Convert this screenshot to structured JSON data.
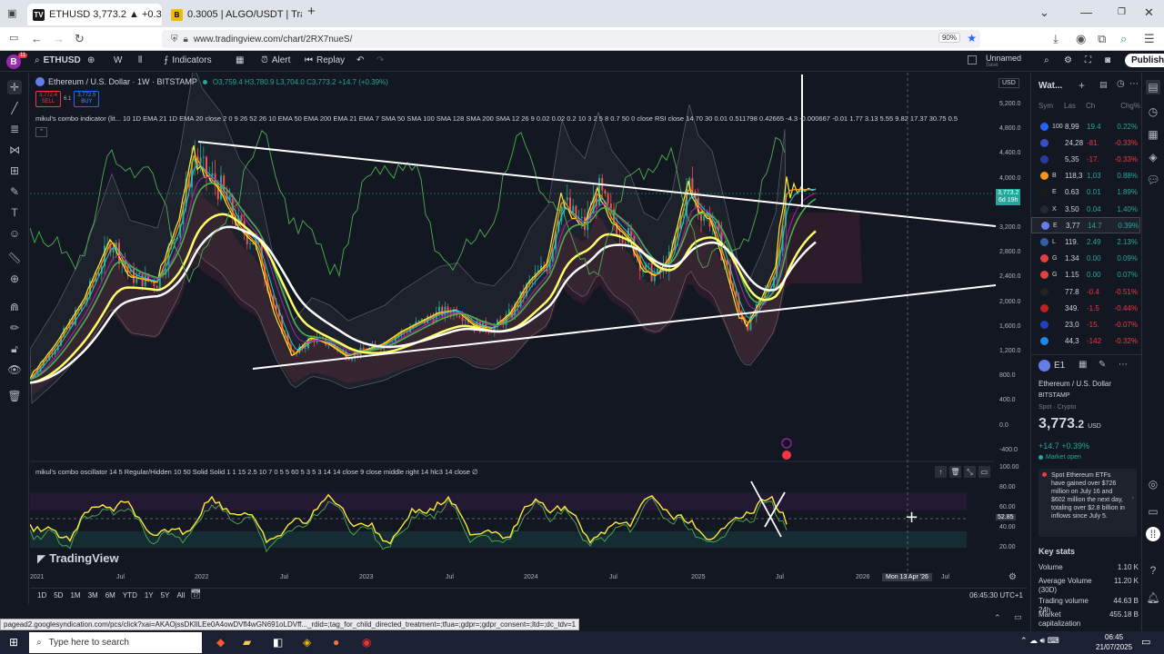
{
  "browser": {
    "tabs": [
      {
        "label": "ETHUSD 3,773.2 ▲ +0.39% Unn",
        "favicon": "tv-icon",
        "active": true
      },
      {
        "label": "0.3005 | ALGO/USDT | Trade AL",
        "favicon": "binance-icon",
        "active": false
      }
    ],
    "url": "www.tradingview.com/chart/2RX7nueS/",
    "zoom": "90%"
  },
  "toolbar": {
    "avatar_letter": "B",
    "avatar_badge": "11",
    "symbol": "ETHUSD",
    "interval": "W",
    "indicators_label": "Indicators",
    "alert_label": "Alert",
    "replay_label": "Replay",
    "layout_name": "Unnamed",
    "layout_sub": "Save",
    "publish_label": "Publish"
  },
  "legend": {
    "title": "Ethereum / U.S. Dollar · 1W · BITSTAMP",
    "ohlc": "O3,759.4 H3,780.9 L3,704.0 C3,773.2 +14.7 (+0.39%)",
    "sell_price": "3,772.4",
    "sell_label": "SELL",
    "spread": "6.1",
    "buy_price": "3,772.5",
    "buy_label": "BUY",
    "indicator1": "mikul's combo indicator (lit... 10 1D EMA 21 1D EMA 20 close 2 0 9 26 52 26 10 EMA 50 EMA 200 EMA 21 EMA 7 SMA 50 SMA 100 SMA 128 SMA 200 SMA 12 26 9 0.02 0.02 0.2 10 3 2 5 8 0.7 50 0 close RSI close 14 70 30 0.01 0.511798 0.42665 -4.3 -0.000667 -0.01 1.77 3.13 5.55 9.82 17.37 30.75 0.5",
    "indicator2": "mikul's combo oscillator 14 5 Regular/Hidden 10 50 Solid Solid 1 1 15 2.5 10 7 0 5 5 60 5 3 5 3 14 14 close 9 close middle right 14 hlc3 14 close ∅"
  },
  "price_axis": {
    "currency": "USD",
    "ticks": [
      "5,200.0",
      "4,800.0",
      "4,400.0",
      "4,000.0",
      "3,600.0",
      "3,200.0",
      "2,800.0",
      "2,400.0",
      "2,000.0",
      "1,600.0",
      "1,200.0",
      "800.0",
      "400.0",
      "0.0",
      "-400.0"
    ],
    "last_price": "3,773.2",
    "countdown": "6d 19h"
  },
  "osc_axis": {
    "ticks": [
      "100.00",
      "80.00",
      "60.00",
      "40.00",
      "20.00"
    ],
    "current": "52.85"
  },
  "time_axis": {
    "labels": [
      "2021",
      "Jul",
      "2022",
      "Jul",
      "2023",
      "Jul",
      "2024",
      "Jul",
      "2025",
      "Jul",
      "2026",
      "Jul"
    ],
    "crosshair_label": "Mon 13 Apr '26"
  },
  "ranges": [
    "1D",
    "5D",
    "1M",
    "3M",
    "6M",
    "YTD",
    "1Y",
    "5Y",
    "All"
  ],
  "clock": "06:45:30 UTC+1",
  "logo": "TradingView",
  "watchlist": {
    "title": "Wat...",
    "headers": [
      "Sym",
      "Las",
      "Ch",
      "Chg%"
    ],
    "rows": [
      {
        "sym": "100",
        "last": "8,99",
        "chg": "19.4",
        "pct": "0.22%",
        "color": "#2962ff",
        "up": true
      },
      {
        "sym": "",
        "last": "24,28",
        "chg": "-81.",
        "pct": "-0.33%",
        "color": "#3b4cca",
        "up": false
      },
      {
        "sym": "",
        "last": "5,35",
        "chg": "-17.",
        "pct": "-0.33%",
        "color": "#2a3aa0",
        "up": false
      },
      {
        "sym": "B",
        "last": "118,3",
        "chg": "1,03",
        "pct": "0.88%",
        "color": "#f7931a",
        "up": true
      },
      {
        "sym": "E",
        "last": "0.63",
        "chg": "0.01",
        "pct": "1.89%",
        "color": "#1a1a1a",
        "up": true
      },
      {
        "sym": "X",
        "last": "3.50",
        "chg": "0.04",
        "pct": "1.40%",
        "color": "#23292f",
        "up": true
      },
      {
        "sym": "E",
        "last": "3,77",
        "chg": "14.7",
        "pct": "0.39%",
        "color": "#627eea",
        "up": true
      },
      {
        "sym": "L",
        "last": "119.",
        "chg": "2.49",
        "pct": "2.13%",
        "color": "#345d9d",
        "up": true
      },
      {
        "sym": "G",
        "last": "1.34",
        "chg": "0.00",
        "pct": "0.09%",
        "color": "#e04040",
        "up": true
      },
      {
        "sym": "G",
        "last": "1.15",
        "chg": "0.00",
        "pct": "0.07%",
        "color": "#e04040",
        "up": true
      },
      {
        "sym": "",
        "last": "77.8",
        "chg": "-0.4",
        "pct": "-0.51%",
        "color": "#222",
        "up": false
      },
      {
        "sym": "",
        "last": "349.",
        "chg": "-1.5",
        "pct": "-0.44%",
        "color": "#c02020",
        "up": false
      },
      {
        "sym": "",
        "last": "23,0",
        "chg": "-15.",
        "pct": "-0.07%",
        "color": "#2040c0",
        "up": false
      },
      {
        "sym": "",
        "last": "44,3",
        "chg": "-142",
        "pct": "-0.32%",
        "color": "#1e88e5",
        "up": false
      }
    ]
  },
  "details": {
    "symbol": "E1",
    "name": "Ethereum / U.S. Dollar",
    "exchange": "BITSTAMP",
    "category": "Spot · Crypto",
    "price_main": "3,773",
    "price_frac": ".2",
    "currency": "USD",
    "change": "+14.7 +0.39%",
    "market_status": "Market open",
    "news": "Spot Ethereum ETFs have gained over $726 million on July 16 and $602 million the next day, totaling over $2.8 billion in inflows since July 5.",
    "key_stats_title": "Key stats",
    "stats": [
      {
        "label": "Volume",
        "value": "1.10 K"
      },
      {
        "label": "Average Volume (30D)",
        "value": "11.20 K"
      },
      {
        "label": "Trading volume 24h",
        "value": "44.63 B"
      },
      {
        "label": "Market capitalization",
        "value": "455.18 B"
      }
    ]
  },
  "status_url": "pagead2.googlesyndication.com/pcs/click?xai=AKAOjssDKlILEe0A4owDVfl4wGN691oLDVff..._rdid=;tag_for_child_directed_treatment=;tfua=;gdpr=;gdpr_consent=;ltd=;dc_tdv=1",
  "taskbar": {
    "search_placeholder": "Type here to search",
    "time": "06:45",
    "date": "21/07/2025"
  },
  "colors": {
    "accent": "#2962ff",
    "up": "#26a69a",
    "down": "#ef5350",
    "bg": "#131722"
  }
}
